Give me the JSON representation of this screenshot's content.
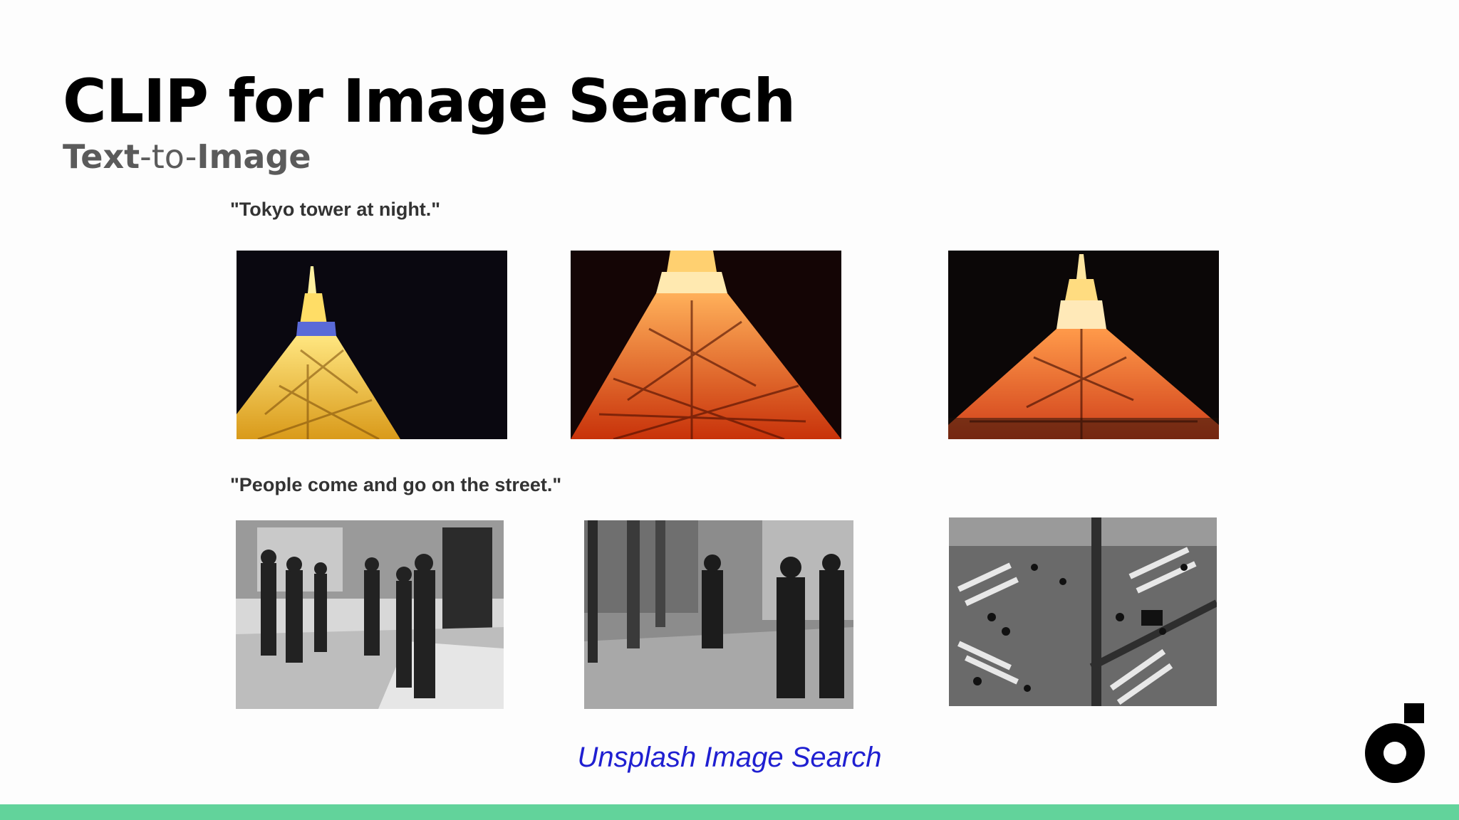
{
  "slide": {
    "title": "CLIP for Image Search",
    "subtitle": {
      "part1": "Text",
      "sep1": "-to-",
      "part2": "Image"
    },
    "queries": [
      {
        "text": "\"Tokyo tower at night.\""
      },
      {
        "text": "\"People come and go on the street.\""
      }
    ],
    "caption": "Unsplash Image Search"
  },
  "colors": {
    "accent_bar": "#62d39b",
    "link": "#1f1fd1",
    "title": "#000000",
    "subtitle": "#5b5b5b"
  },
  "icons": {
    "brand_logo": "brand-logo-icon"
  }
}
